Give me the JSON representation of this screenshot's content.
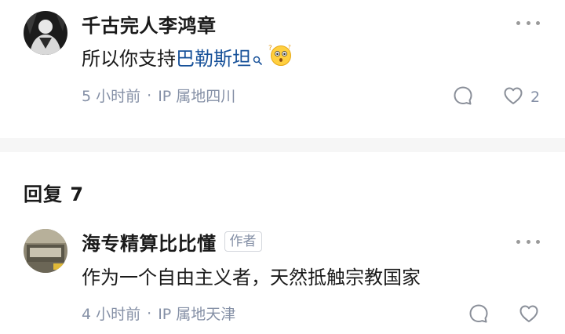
{
  "top_comment": {
    "author": "千古完人李鸿章",
    "content_prefix": "所以你支持",
    "content_link": "巴勒斯坦",
    "time": "5 小时前",
    "separator": "·",
    "ip_location": "IP 属地四川",
    "like_count": "2",
    "icons": {
      "more": "more-dots-icon",
      "search": "search-mini-icon",
      "emoji": "shocked-face-emoji",
      "reply": "comment-bubble-icon",
      "like": "heart-icon"
    }
  },
  "replies_section": {
    "title": "回复 7"
  },
  "reply_comment": {
    "author": "海专精算比比懂",
    "badge": "作者",
    "content": "作为一个自由主义者，天然抵触宗教国家",
    "time": "4 小时前",
    "separator": "·",
    "ip_location": "IP 属地天津"
  },
  "colors": {
    "link": "#175199",
    "meta_text": "#8590a6",
    "divider": "#f6f6f6"
  }
}
